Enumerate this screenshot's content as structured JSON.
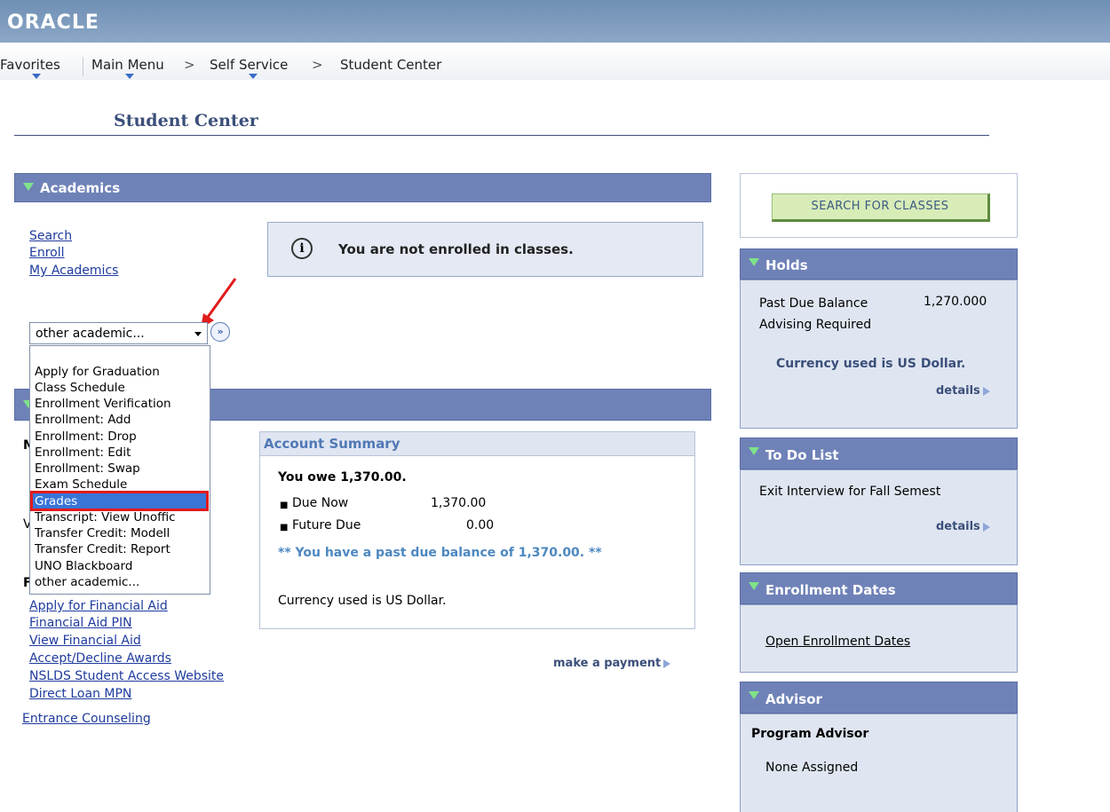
{
  "header": {
    "logo": "ORACLE"
  },
  "nav": {
    "favorites": "Favorites",
    "main_menu": "Main Menu",
    "self_service": "Self Service",
    "student_center": "Student Center",
    "sep": ">"
  },
  "page_title": "Student Center",
  "academics": {
    "title": "Academics",
    "links": [
      "Search",
      "Enroll",
      "My Academics"
    ],
    "notice": "You are not enrolled in classes.",
    "info_icon": "i",
    "select_value": "other academic...",
    "go_label": "»",
    "dropdown_options": [
      "Apply for Graduation",
      "Class Schedule",
      "Enrollment Verification",
      "Enrollment: Add",
      "Enrollment: Drop",
      "Enrollment: Edit",
      "Enrollment: Swap",
      "Exam Schedule",
      "Grades",
      "Transcript: View Unoffic",
      "Transfer Credit: Modell",
      "Transfer Credit: Report",
      "UNO Blackboard",
      "other academic..."
    ],
    "selected_option": "Grades"
  },
  "finances": {
    "partial_letters": [
      "M",
      "V",
      "F"
    ]
  },
  "account_summary": {
    "title": "Account Summary",
    "you_owe": "You owe 1,370.00.",
    "due_now_label": "Due Now",
    "due_now_value": "1,370.00",
    "future_due_label": "Future Due",
    "future_due_value": "0.00",
    "past_due_msg": "** You have a past due balance of 1,370.00. **",
    "currency": "Currency used is US Dollar.",
    "make_payment": "make a payment"
  },
  "financial_aid_links": [
    "Apply for Financial Aid",
    "Financial Aid PIN",
    "View Financial Aid",
    "Accept/Decline Awards",
    "NSLDS Student Access Website",
    "Direct Loan MPN",
    "Entrance Counseling"
  ],
  "search_button": "SEARCH FOR CLASSES",
  "holds": {
    "title": "Holds",
    "item1_label": "Past Due Balance",
    "item1_value": "1,270.000",
    "item2_label": "Advising Required",
    "currency": "Currency used is US Dollar.",
    "details": "details"
  },
  "todo": {
    "title": "To Do List",
    "item": "Exit Interview for Fall Semest",
    "details": "details"
  },
  "enrollment_dates": {
    "title": "Enrollment Dates",
    "link": "Open Enrollment Dates"
  },
  "advisor": {
    "title": "Advisor",
    "program_advisor": "Program Advisor",
    "none": "None Assigned"
  },
  "colors": {
    "header_blue": "#6f82b8",
    "panel_bg": "#dfe6f1",
    "link": "#1f3b9e",
    "highlight": "#3875d7",
    "annotation_red": "#e21b1b",
    "button_green": "#d8ecb8"
  }
}
